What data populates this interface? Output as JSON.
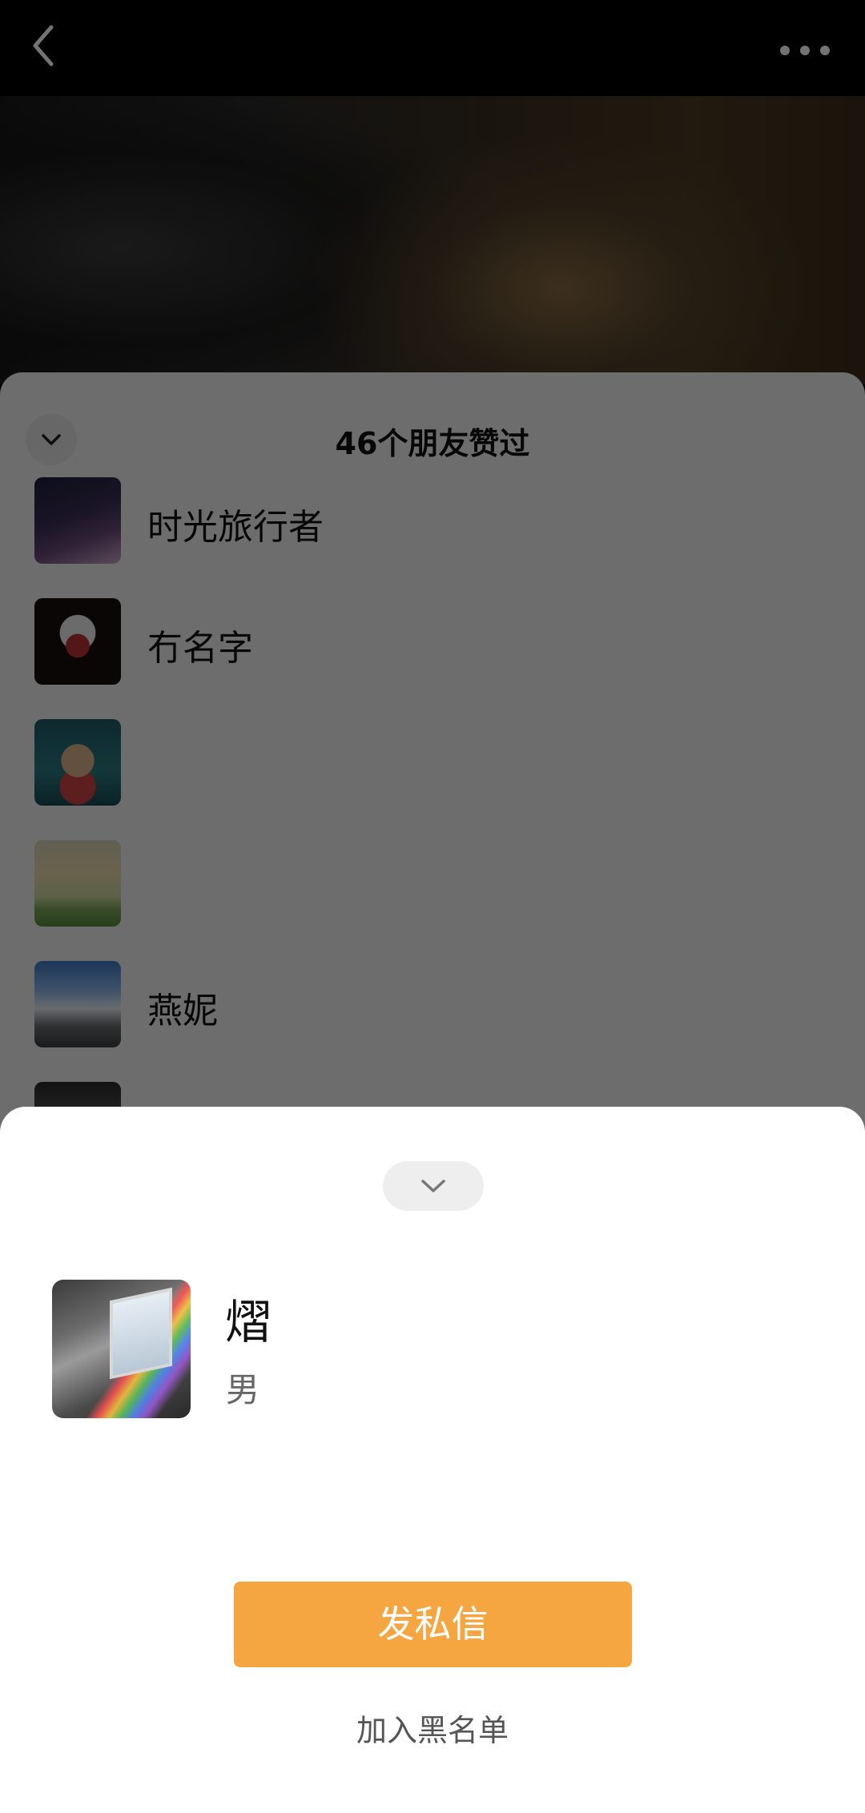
{
  "top_bar": {
    "back_icon": "chevron-left-icon",
    "more_icon": "more-dots-icon"
  },
  "likes_panel": {
    "title": "46个朋友赞过",
    "collapse_icon": "chevron-down-icon",
    "items": [
      {
        "name": "时光旅行者"
      },
      {
        "name": "冇名字"
      },
      {
        "name": ""
      },
      {
        "name": ""
      },
      {
        "name": "燕妮"
      },
      {
        "name": ""
      }
    ]
  },
  "profile": {
    "handle_icon": "chevron-down-icon",
    "name": "熠",
    "gender": "男",
    "message_button": "发私信",
    "blacklist_link": "加入黑名单",
    "accent_color": "#f5a640"
  }
}
